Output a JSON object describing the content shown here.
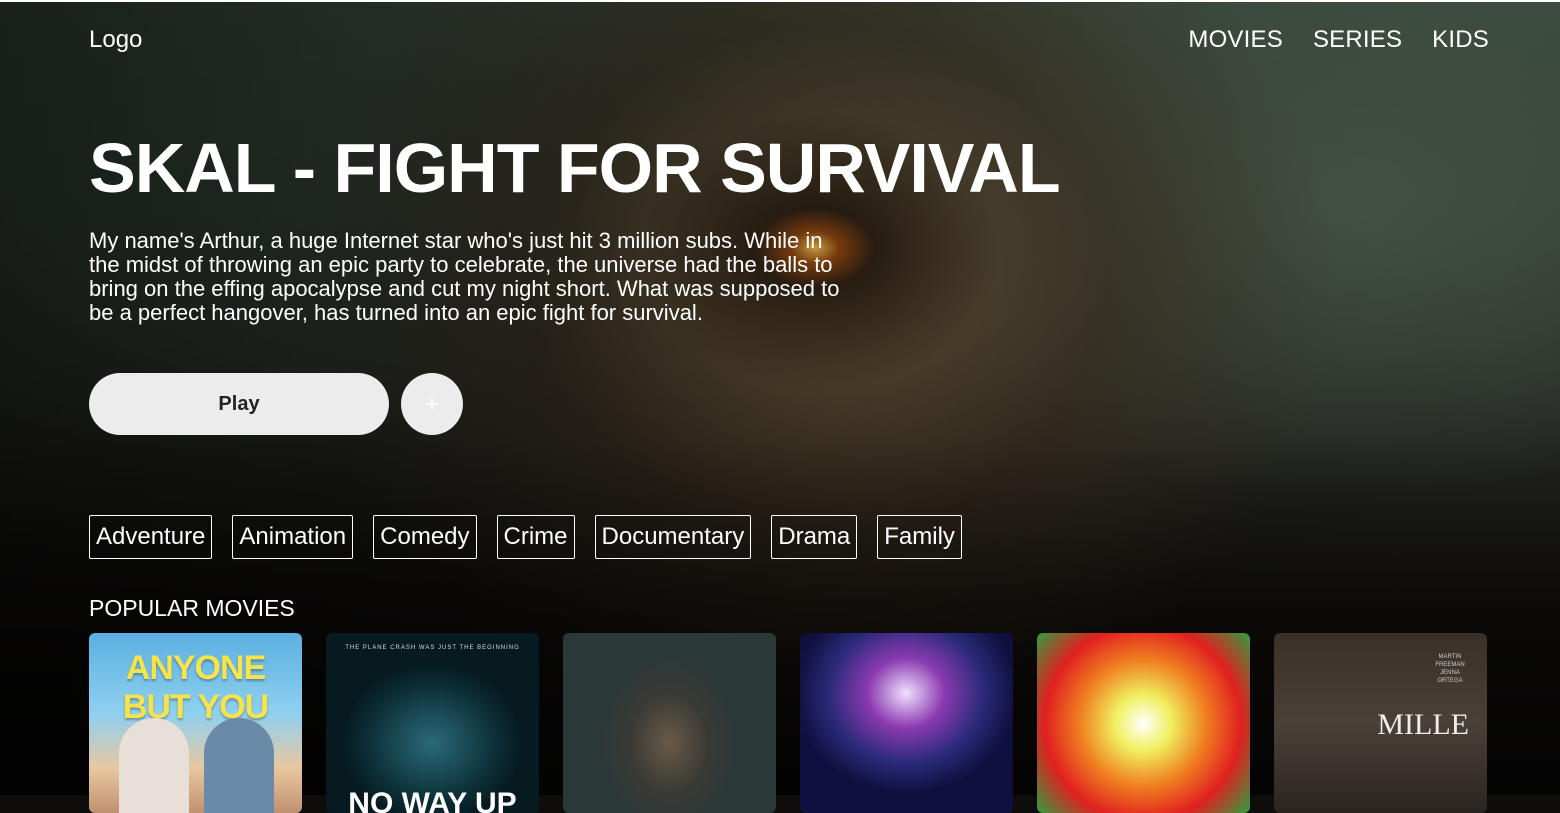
{
  "header": {
    "logo": "Logo",
    "nav": [
      {
        "label": "MOVIES"
      },
      {
        "label": "SERIES"
      },
      {
        "label": "KIDS"
      }
    ]
  },
  "hero": {
    "title": "SKAL - FIGHT FOR SURVIVAL",
    "description": "My name's Arthur, a huge Internet star who's just hit 3 million subs. While in the midst of throwing an epic party to celebrate, the universe had the balls to bring on the effing apocalypse and cut my night short. What was supposed to be a perfect hangover, has turned into an epic fight for survival.",
    "play_label": "Play",
    "add_label": "+"
  },
  "genres": [
    "Adventure",
    "Animation",
    "Comedy",
    "Crime",
    "Documentary",
    "Drama",
    "Family"
  ],
  "popular": {
    "title": "POPULAR MOVIES",
    "posters": [
      {
        "text": "ANYONE BUT YOU"
      },
      {
        "tagline": "THE PLANE CRASH WAS JUST THE BEGINNING",
        "text": "NO WAY UP"
      },
      {
        "text": ""
      },
      {
        "text": ""
      },
      {
        "text": ""
      },
      {
        "credits": "MARTIN FREEMAN JENNA ORTEGA",
        "side": "MILLE"
      }
    ]
  }
}
